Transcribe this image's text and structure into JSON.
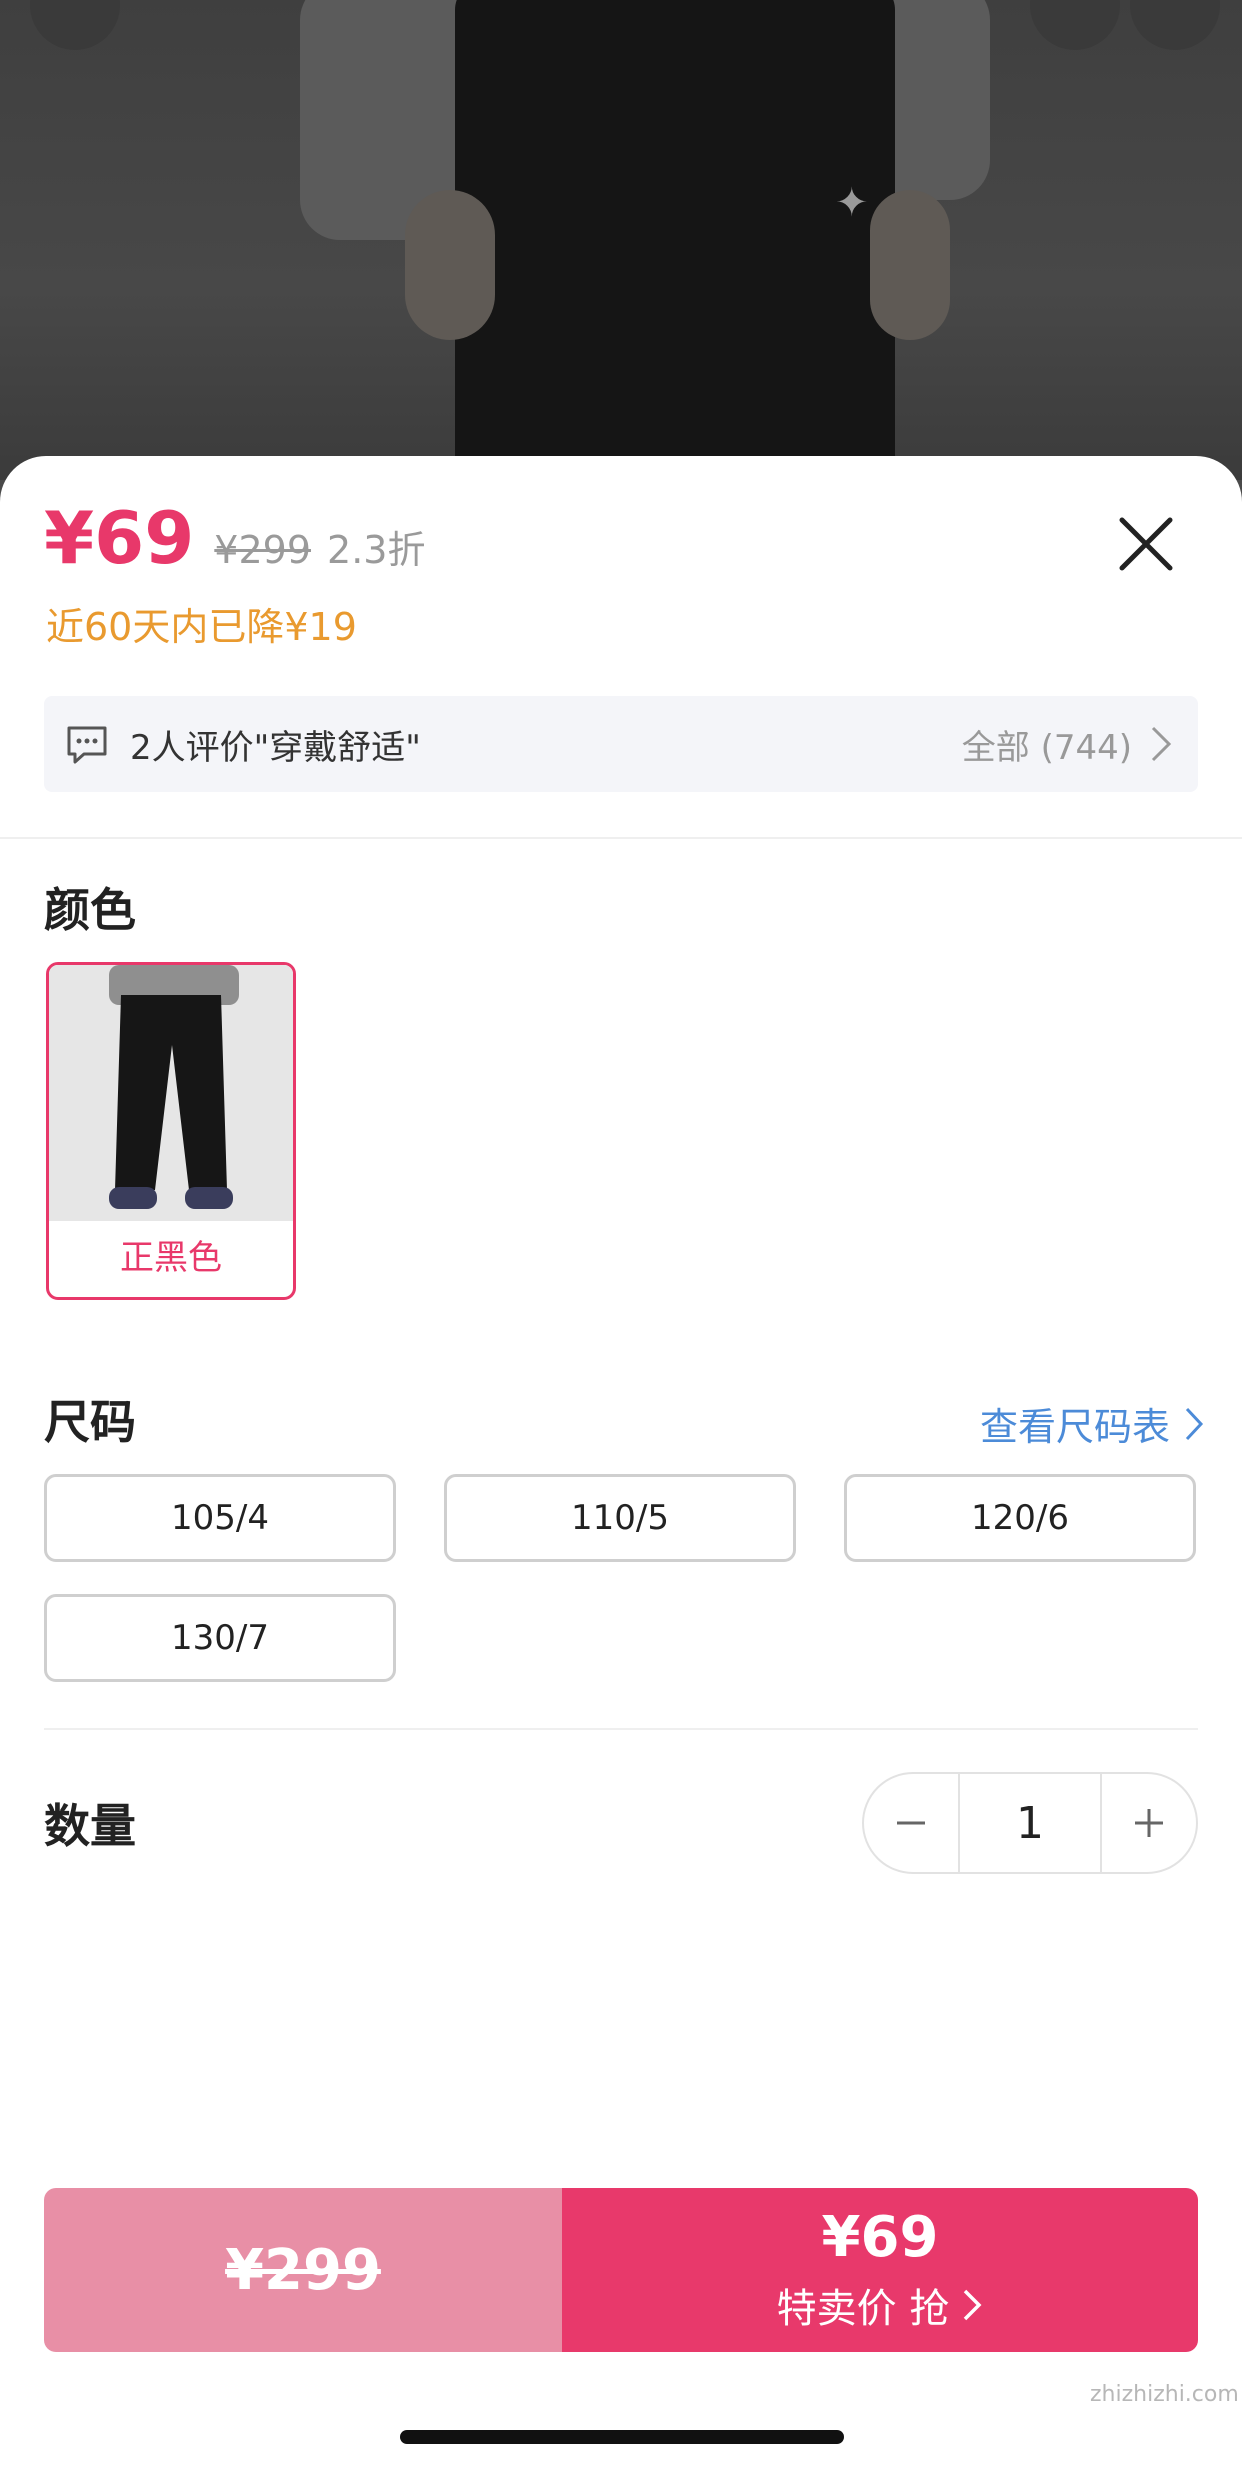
{
  "header": {
    "price": "¥69",
    "original_price": "¥299",
    "discount": "2.3折",
    "price_drop_note": "近60天内已降¥19"
  },
  "reviews": {
    "summary": "2人评价\"穿戴舒适\"",
    "all_label": "全部 (744)"
  },
  "color_section": {
    "title": "颜色",
    "options": [
      {
        "label": "正黑色",
        "selected": true
      }
    ]
  },
  "size_section": {
    "title": "尺码",
    "size_chart_link": "查看尺码表",
    "options": [
      "105/4",
      "110/5",
      "120/6",
      "130/7"
    ]
  },
  "quantity_section": {
    "title": "数量",
    "value": "1"
  },
  "buy_bar": {
    "original_price": "¥299",
    "sale_price": "¥69",
    "action_label": "特卖价 抢"
  },
  "watermark": "zhizhizhi.com",
  "colors": {
    "accent": "#e8386a",
    "drop_note": "#e99a2f",
    "link": "#4c8bd8"
  }
}
